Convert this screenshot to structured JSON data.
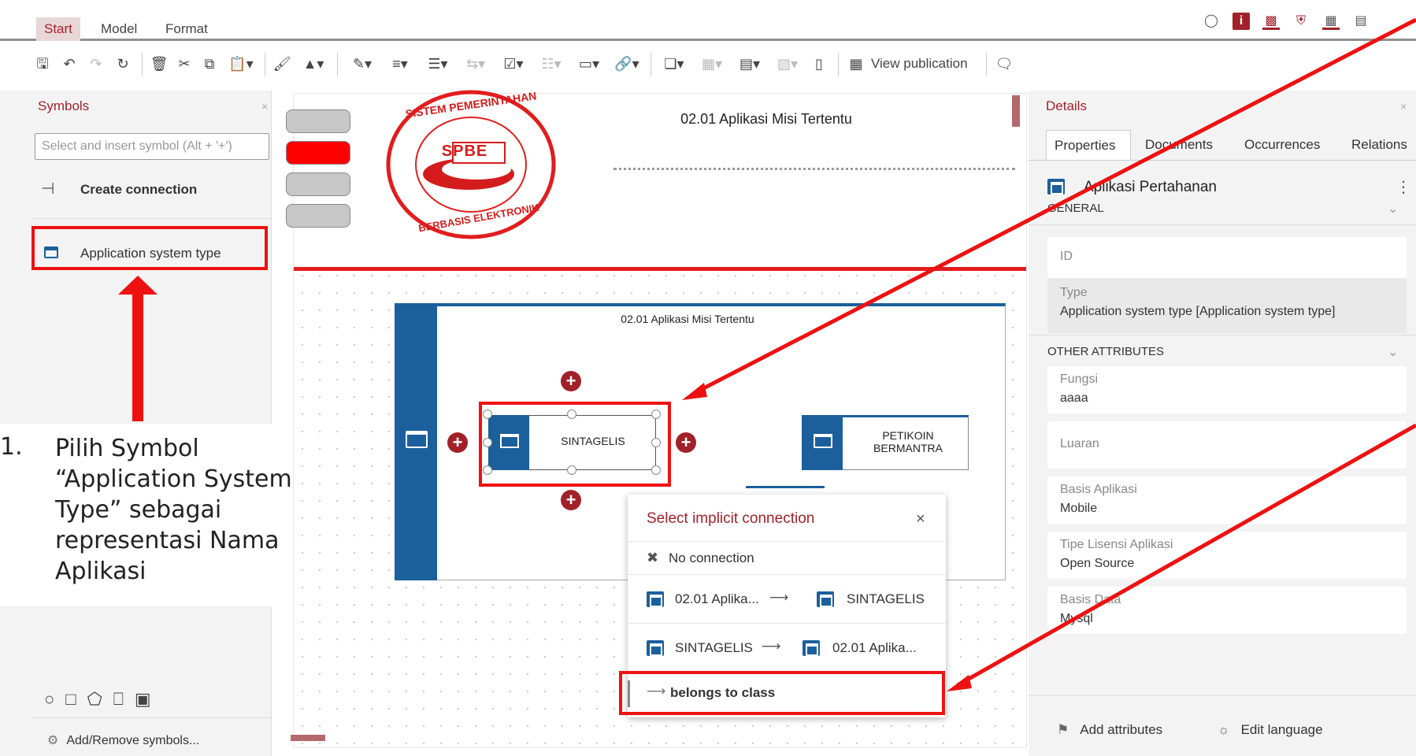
{
  "menubar": {
    "tabs": [
      "Start",
      "Model",
      "Format"
    ],
    "icons": [
      "search-options-icon",
      "info-icon",
      "chart-icon",
      "shield-icon",
      "grid-icon",
      "comments-icon"
    ]
  },
  "toolbar": {
    "view_publication": "View publication"
  },
  "symbols_panel": {
    "title": "Symbols",
    "close": "×",
    "search_placeholder": "Select and insert symbol (Alt + '+')",
    "create_connection": "Create connection",
    "item": "Application system type",
    "add_remove": "Add/Remove symbols..."
  },
  "annotation": {
    "number": "1.",
    "text": "Pilih Symbol “Application System Type” sebagai representasi Nama Aplikasi"
  },
  "canvas": {
    "header_title": "02.01 Aplikasi Misi Tertentu",
    "logo": {
      "top_text": "SISTEM PEMERINTAHAN",
      "bottom_text": "BERBASIS ELEKTRONIK",
      "center": "SPBE"
    },
    "lane_title": "02.01 Aplikasi Misi Tertentu",
    "node_sintagelis": "SINTAGELIS",
    "node_petikoin": "PETIKOIN BERMANTRA"
  },
  "popup": {
    "title": "Select implicit connection",
    "close": "×",
    "no_connection": "No connection",
    "row1_from": "02.01 Aplika...",
    "row1_to": "SINTAGELIS",
    "row2_from": "SINTAGELIS",
    "row2_to": "02.01 Aplika...",
    "belongs": "belongs to class",
    "arrow": "⟶"
  },
  "details": {
    "title": "Details",
    "close": "×",
    "tabs": [
      "Properties",
      "Documents",
      "Occurrences",
      "Relations"
    ],
    "object_name": "Aplikasi Pertahanan",
    "general": "GENERAL",
    "id_label": "ID",
    "type_label": "Type",
    "type_value": "Application system type [Application system type]",
    "other_attributes": "OTHER ATTRIBUTES",
    "attrs": [
      {
        "label": "Fungsi",
        "value": "aaaa"
      },
      {
        "label": "Luaran",
        "value": ""
      },
      {
        "label": "Basis Aplikasi",
        "value": "Mobile"
      },
      {
        "label": "Tipe Lisensi Aplikasi",
        "value": "Open Source"
      },
      {
        "label": "Basis Data",
        "value": "Mysql"
      }
    ],
    "add_attributes": "Add attributes",
    "edit_language": "Edit language"
  },
  "colors": {
    "accent": "#a1212a",
    "blue": "#1b5f9c",
    "annotation_red": "#ee1111"
  }
}
